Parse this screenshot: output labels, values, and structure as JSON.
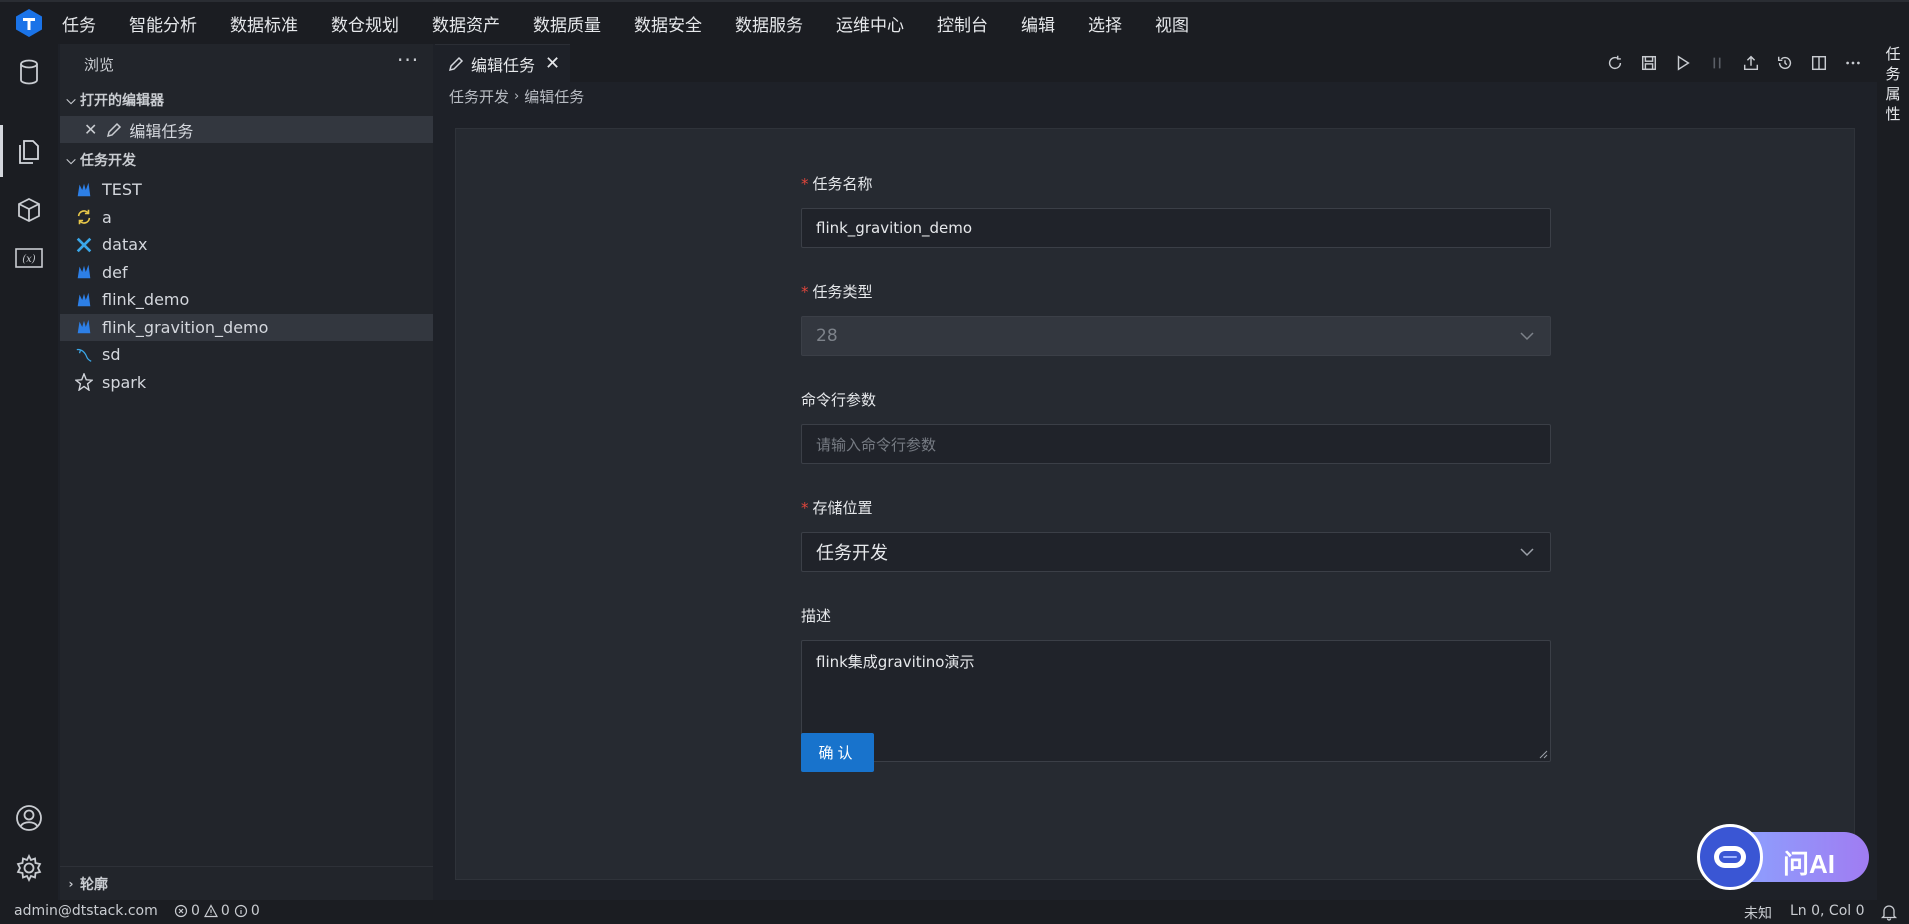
{
  "menubar": {
    "items": [
      "任务",
      "智能分析",
      "数据标准",
      "数仓规划",
      "数据资产",
      "数据质量",
      "数据安全",
      "数据服务",
      "运维中心",
      "控制台",
      "编辑",
      "选择",
      "视图"
    ]
  },
  "sidebar": {
    "title": "浏览",
    "more": "···",
    "open_editors_label": "打开的编辑器",
    "open_editor_item": "编辑任务",
    "task_dev_label": "任务开发",
    "tree": [
      {
        "label": "TEST",
        "icon": "flink-icon"
      },
      {
        "label": "a",
        "icon": "sync-icon"
      },
      {
        "label": "datax",
        "icon": "datax-icon"
      },
      {
        "label": "def",
        "icon": "flink-icon"
      },
      {
        "label": "flink_demo",
        "icon": "flink-icon"
      },
      {
        "label": "flink_gravition_demo",
        "icon": "flink-icon"
      },
      {
        "label": "sd",
        "icon": "mysql-icon"
      },
      {
        "label": "spark",
        "icon": "spark-icon"
      }
    ],
    "outline_label": "轮廓"
  },
  "editor": {
    "tab_label": "编辑任务",
    "breadcrumb": [
      "任务开发",
      "编辑任务"
    ],
    "form": {
      "name_label": "任务名称",
      "name_value": "flink_gravition_demo",
      "type_label": "任务类型",
      "type_value": "28",
      "args_label": "命令行参数",
      "args_placeholder": "请输入命令行参数",
      "location_label": "存储位置",
      "location_value": "任务开发",
      "desc_label": "描述",
      "desc_value": "flink集成gravitino演示",
      "confirm_label": "确认"
    }
  },
  "right_panel": {
    "label": "任务属性"
  },
  "ask_ai": {
    "label": "问AI"
  },
  "statusbar": {
    "user": "admin@dtstack.com",
    "errors": "0",
    "warnings": "0",
    "infos": "0",
    "language": "未知",
    "position": "Ln 0, Col 0"
  },
  "colors": {
    "accent": "#1873cc",
    "required": "#e0463c",
    "flink_blue": "#2d7fe6"
  }
}
